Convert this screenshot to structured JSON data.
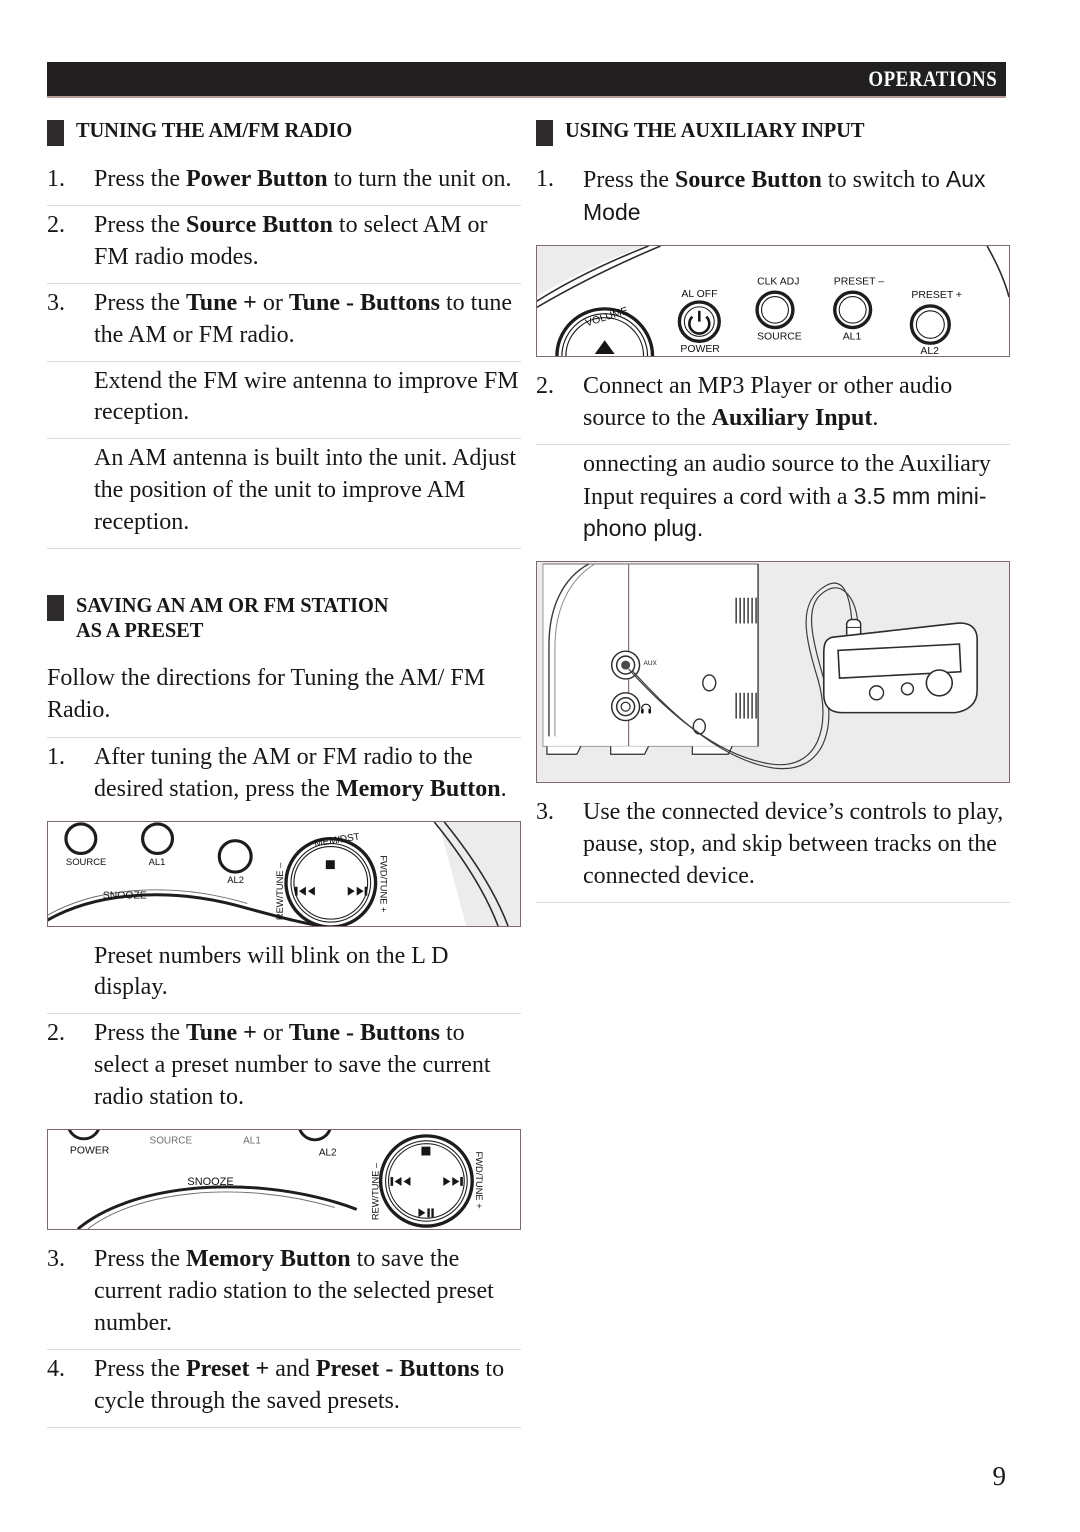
{
  "header": {
    "title": "OPERATIONS"
  },
  "page": {
    "number": "9"
  },
  "left_column": {
    "section1": {
      "heading": "TUNING THE AM/FM RADIO",
      "steps": [
        {
          "num": "1.",
          "parts": [
            {
              "t": "Press the ",
              "b": false
            },
            {
              "t": "Power Button",
              "b": true
            },
            {
              "t": " to turn the unit on.",
              "b": false
            }
          ]
        },
        {
          "num": "2.",
          "parts": [
            {
              "t": "Press the ",
              "b": false
            },
            {
              "t": "Source Button",
              "b": true
            },
            {
              "t": " to select AM or FM radio modes.",
              "b": false
            }
          ]
        },
        {
          "num": "3.",
          "parts": [
            {
              "t": "Press the ",
              "b": false
            },
            {
              "t": "Tune +",
              "b": true
            },
            {
              "t": " or ",
              "b": false
            },
            {
              "t": "Tune - Buttons",
              "b": true
            },
            {
              "t": " to tune the AM or FM radio.",
              "b": false
            }
          ]
        },
        {
          "num": "",
          "parts": [
            {
              "t": "Extend the FM wire antenna to improve FM reception.",
              "b": false
            }
          ]
        },
        {
          "num": "",
          "parts": [
            {
              "t": "An AM antenna is built into the unit. Adjust the position of the unit to improve AM reception.",
              "b": false
            }
          ]
        }
      ]
    },
    "section2": {
      "heading": "SAVING AN AM OR FM STATION\nAS A PRESET",
      "intro": "Follow the directions for Tuning the AM/ FM Radio.",
      "step1": {
        "num": "1.",
        "parts": [
          {
            "t": "After tuning the AM or FM radio to the desired station, press the ",
            "b": false
          },
          {
            "t": "Memory Button",
            "b": true
          },
          {
            "t": ".",
            "b": false
          }
        ]
      },
      "note1": "Preset numbers will blink on the L   D display.",
      "step2": {
        "num": "2.",
        "parts": [
          {
            "t": "Press the ",
            "b": false
          },
          {
            "t": "Tune +",
            "b": true
          },
          {
            "t": " or ",
            "b": false
          },
          {
            "t": "Tune - Buttons",
            "b": true
          },
          {
            "t": " to select a preset number to save the current radio station to.",
            "b": false
          }
        ]
      },
      "step3": {
        "num": "3.",
        "parts": [
          {
            "t": "Press the ",
            "b": false
          },
          {
            "t": "Memory Button",
            "b": true
          },
          {
            "t": " to save the current radio station to the selected preset number.",
            "b": false
          }
        ]
      },
      "step4": {
        "num": "4.",
        "parts": [
          {
            "t": "Press the ",
            "b": false
          },
          {
            "t": "Preset +",
            "b": true
          },
          {
            "t": " and ",
            "b": false
          },
          {
            "t": "Preset - Buttons",
            "b": true
          },
          {
            "t": " to cycle through the saved presets.",
            "b": false
          }
        ]
      }
    },
    "figure_top_panel": {
      "labels": [
        "SOURCE",
        "AL1",
        "AL2",
        "SNOOZE",
        "MEM/DST",
        "REW/TUNE –",
        "FWD/TUNE +"
      ]
    },
    "figure_bottom_panel": {
      "labels": [
        "POWER",
        "SOURCE",
        "AL1",
        "AL2",
        "SNOOZE",
        "REW/TUNE –",
        "FWD/TUNE +"
      ]
    }
  },
  "right_column": {
    "section1": {
      "heading": "USING THE AUXILIARY INPUT",
      "step1": {
        "num": "1.",
        "parts": [
          {
            "t": "Press the ",
            "b": false
          },
          {
            "t": "Source Button",
            "b": true
          },
          {
            "t": " to switch to ",
            "b": false
          },
          {
            "t": "Aux Mode",
            "b": false,
            "sans": true
          }
        ]
      },
      "step2": {
        "num": "2.",
        "parts": [
          {
            "t": "Connect an MP3 Player or other audio source to the ",
            "b": false
          },
          {
            "t": "Auxiliary Input",
            "b": true
          },
          {
            "t": ".",
            "b": false
          }
        ]
      },
      "note1_a": "   onnecting an audio source to the Auxiliary Input requires a cord with a ",
      "note1_b": "3.5 mm mini-phono plug.",
      "step3": {
        "num": "3.",
        "parts": [
          {
            "t": "Use the connected device’s controls to play, pause, stop, and skip between tracks on the connected device.",
            "b": false
          }
        ]
      }
    },
    "figure_front_panel": {
      "labels": [
        "VOLUME",
        "AL OFF",
        "POWER",
        "CLK ADJ",
        "SOURCE",
        "PRESET –",
        "AL1",
        "PRESET +",
        "AL2"
      ]
    },
    "figure_aux_connection": {
      "labels": [
        "AUX"
      ]
    }
  }
}
